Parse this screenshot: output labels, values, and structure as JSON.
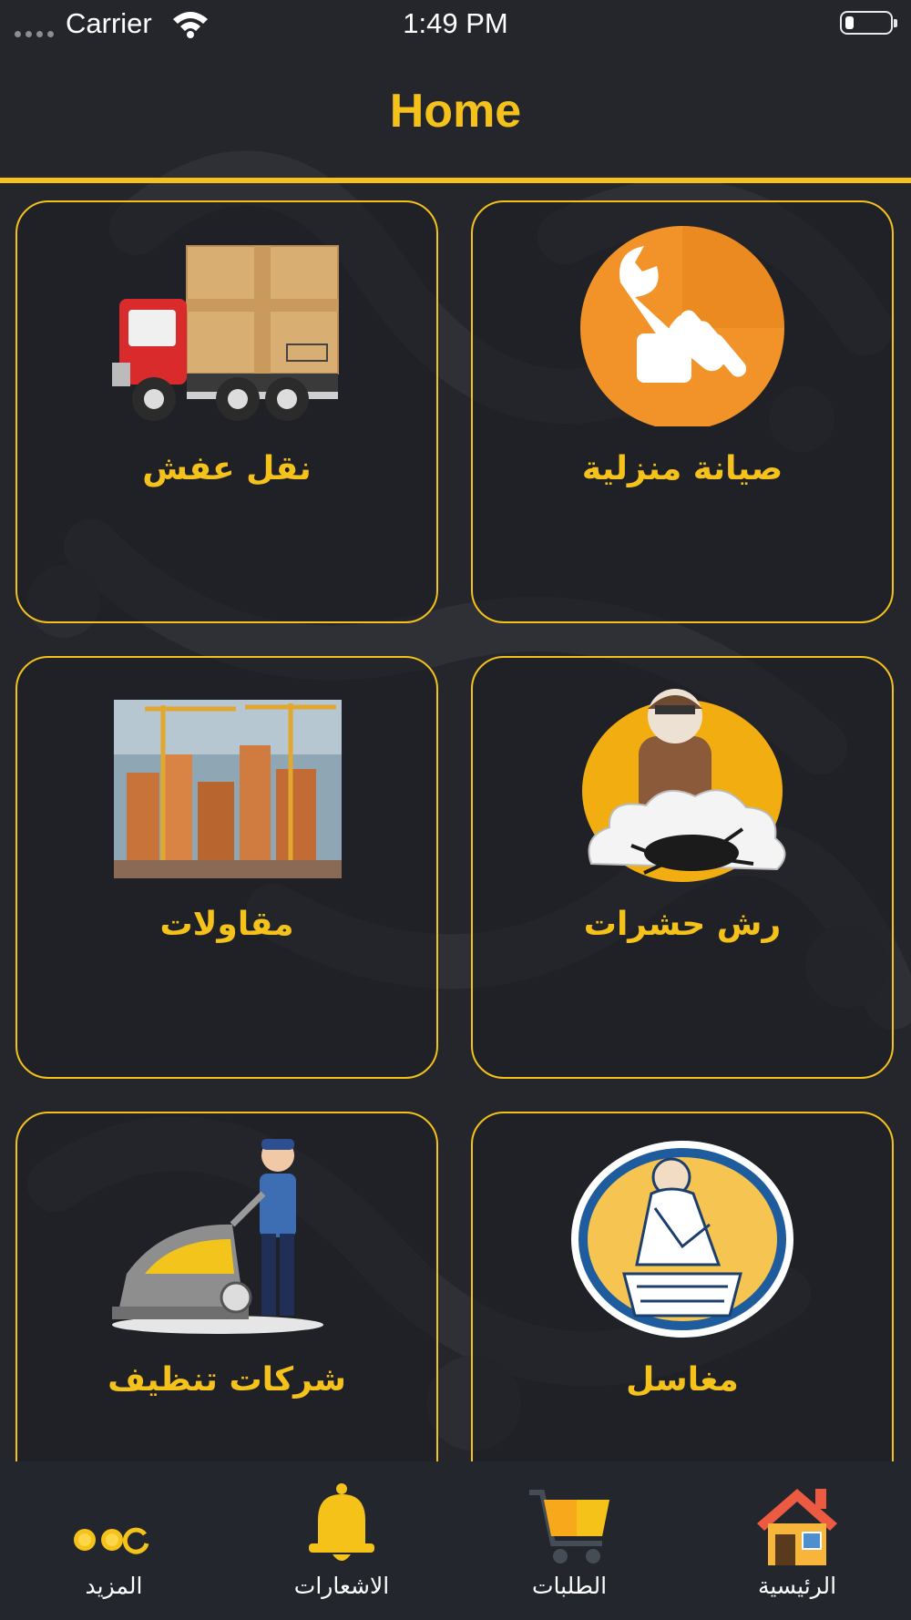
{
  "status_bar": {
    "carrier": "Carrier",
    "time": "1:49 PM"
  },
  "header": {
    "title": "Home"
  },
  "services": [
    {
      "label": "صيانة منزلية",
      "icon": "wrench-icon"
    },
    {
      "label": "نقل عفش",
      "icon": "moving-truck-icon"
    },
    {
      "label": "رش حشرات",
      "icon": "pest-control-icon"
    },
    {
      "label": "مقاولات",
      "icon": "construction-icon"
    },
    {
      "label": "مغاسل",
      "icon": "laundry-icon"
    },
    {
      "label": "شركات تنظيف",
      "icon": "cleaning-machine-icon"
    }
  ],
  "tabs": [
    {
      "label": "الرئيسية",
      "icon": "home-icon"
    },
    {
      "label": "الطلبات",
      "icon": "cart-icon"
    },
    {
      "label": "الاشعارات",
      "icon": "bell-icon"
    },
    {
      "label": "المزيد",
      "icon": "more-dots-icon"
    }
  ],
  "colors": {
    "accent": "#f4c21b",
    "background": "#24262b",
    "tabbar": "#23262d"
  }
}
